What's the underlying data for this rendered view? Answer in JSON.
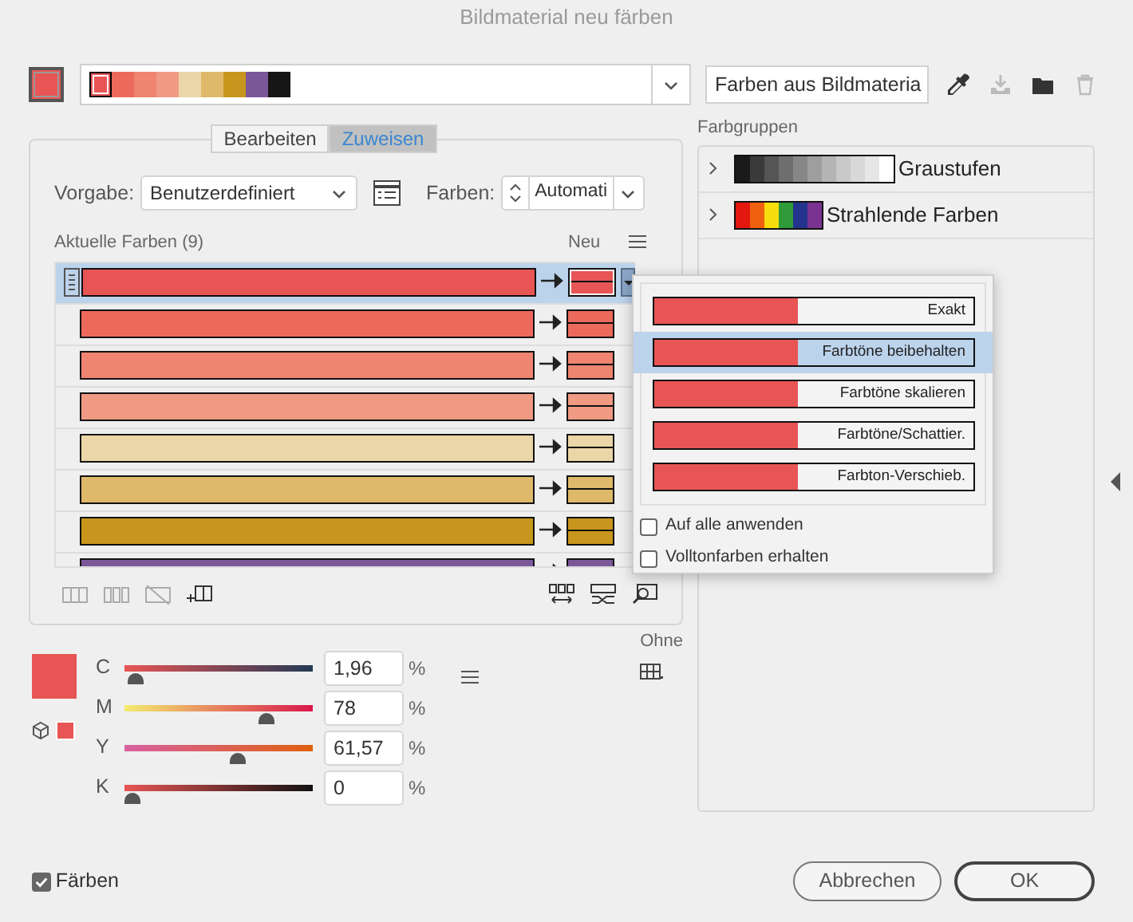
{
  "window": {
    "title": "Bildmaterial neu färben"
  },
  "top": {
    "swatch": {
      "color": "#e85555"
    },
    "strip": [
      {
        "color": "#e85555",
        "selected": true
      },
      {
        "color": "#ec6a5c",
        "selected": false
      },
      {
        "color": "#ef8470",
        "selected": false
      },
      {
        "color": "#f09a84",
        "selected": false
      },
      {
        "color": "#ebd6a8",
        "selected": false
      },
      {
        "color": "#dfb96a",
        "selected": false
      },
      {
        "color": "#c8961c",
        "selected": false
      },
      {
        "color": "#7b579a",
        "selected": false
      },
      {
        "color": "#161616",
        "selected": false
      }
    ],
    "group_field": "Farben aus Bildmateria"
  },
  "tabs": [
    {
      "label": "Bearbeiten",
      "selected": false
    },
    {
      "label": "Zuweisen",
      "selected": true
    }
  ],
  "preset": {
    "label": "Vorgabe:",
    "value": "Benutzerdefiniert"
  },
  "colors_count": {
    "label": "Farben:",
    "value": "Automati"
  },
  "current_colors": {
    "title": "Aktuelle Farben (9)",
    "new_label": "Neu",
    "rows": [
      {
        "color": "#e85555",
        "selected": true
      },
      {
        "color": "#ec6a5c",
        "selected": false
      },
      {
        "color": "#ef8470",
        "selected": false
      },
      {
        "color": "#f09a84",
        "selected": false
      },
      {
        "color": "#ebd6a8",
        "selected": false
      },
      {
        "color": "#dfb96a",
        "selected": false
      },
      {
        "color": "#c8961c",
        "selected": false
      },
      {
        "color": "#7b579a",
        "selected": false
      }
    ]
  },
  "method_menu": {
    "items": [
      {
        "label": "Exakt",
        "selected": false
      },
      {
        "label": "Farbtöne beibehalten",
        "selected": true
      },
      {
        "label": "Farbtöne skalieren",
        "selected": false
      },
      {
        "label": "Farbtöne/Schattier.",
        "selected": false
      },
      {
        "label": "Farbton-Verschieb.",
        "selected": false
      }
    ],
    "options": [
      {
        "label": "Auf alle anwenden",
        "checked": false
      },
      {
        "label": "Volltonfarben erhalten",
        "checked": false
      }
    ]
  },
  "color_groups": {
    "title": "Farbgruppen",
    "groups": [
      {
        "name": "Graustufen",
        "swatches": [
          {
            "color": "#1a1a1a"
          },
          {
            "color": "#3a3a3a"
          },
          {
            "color": "#555555"
          },
          {
            "color": "#6e6e6e"
          },
          {
            "color": "#878787"
          },
          {
            "color": "#9e9e9e"
          },
          {
            "color": "#b4b4b4"
          },
          {
            "color": "#c9c9c9"
          },
          {
            "color": "#d8d8d8"
          },
          {
            "color": "#e6e6e6"
          },
          {
            "color": "#ffffff"
          }
        ]
      },
      {
        "name": "Strahlende Farben",
        "swatches": [
          {
            "color": "#e4170f"
          },
          {
            "color": "#ef6010"
          },
          {
            "color": "#f7dd0b"
          },
          {
            "color": "#2e9a3a"
          },
          {
            "color": "#24348e"
          },
          {
            "color": "#7a3390"
          }
        ]
      }
    ]
  },
  "cmyk": {
    "color": "#e85555",
    "sliders": [
      {
        "channel": "C",
        "level": 0.0196,
        "value": "1,96",
        "unit": "%"
      },
      {
        "channel": "M",
        "level": 0.78,
        "value": "78",
        "unit": "%"
      },
      {
        "channel": "Y",
        "level": 0.6157,
        "value": "61,57",
        "unit": "%"
      },
      {
        "channel": "K",
        "level": 0,
        "value": "0",
        "unit": "%"
      }
    ],
    "none_label": "Ohne"
  },
  "footer": {
    "recolor": {
      "label": "Färben",
      "checked": true
    },
    "buttons": [
      {
        "label": "Abbrechen",
        "kind": "secondary"
      },
      {
        "label": "OK",
        "kind": "default"
      }
    ]
  }
}
